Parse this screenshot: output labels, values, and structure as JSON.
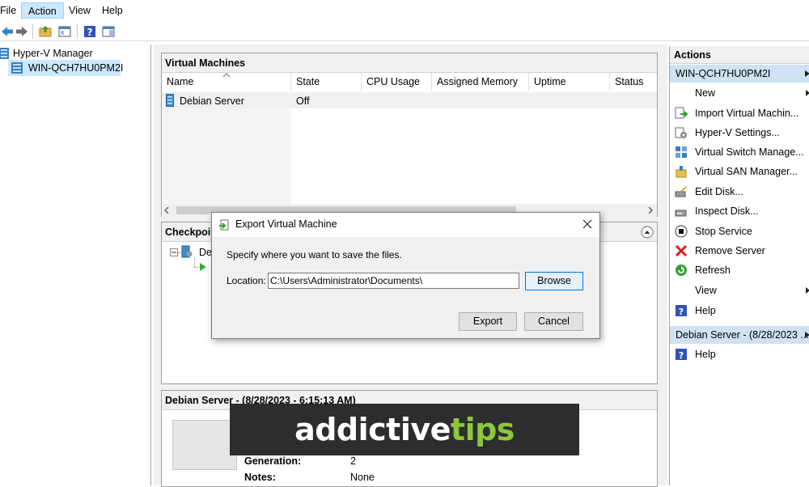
{
  "menu": {
    "file": "File",
    "action": "Action",
    "view": "View",
    "help": "Help"
  },
  "tree": {
    "root": "Hyper-V Manager",
    "server": "WIN-QCH7HU0PM2I"
  },
  "vm_panel": {
    "title": "Virtual Machines",
    "columns": [
      "Name",
      "State",
      "CPU Usage",
      "Assigned Memory",
      "Uptime",
      "Status"
    ],
    "rows": [
      {
        "name": "Debian Server",
        "state": "Off"
      }
    ]
  },
  "checkpoints_panel": {
    "title": "Checkpoi",
    "item": "Deb"
  },
  "details_panel": {
    "title": "Debian Server - (8/28/2023 - 6:15:13 AM)",
    "generation_label": "Generation:",
    "generation_value": "2",
    "notes_label": "Notes:",
    "notes_value": "None"
  },
  "actions": {
    "title": "Actions",
    "server_section": "WIN-QCH7HU0PM2I",
    "items": [
      "New",
      "Import Virtual Machin...",
      "Hyper-V Settings...",
      "Virtual Switch Manage...",
      "Virtual SAN Manager...",
      "Edit Disk...",
      "Inspect Disk...",
      "Stop Service",
      "Remove Server",
      "Refresh",
      "View",
      "Help"
    ],
    "vm_section": "Debian Server - (8/28/2023 ...",
    "vm_items": [
      "Help"
    ]
  },
  "dialog": {
    "title": "Export Virtual Machine",
    "instruction": "Specify where you want to save the files.",
    "location_label": "Location:",
    "location_value": "C:\\Users\\Administrator\\Documents\\",
    "browse": "Browse",
    "export": "Export",
    "cancel": "Cancel"
  },
  "watermark": {
    "part1": "addictive",
    "part2": "tips"
  },
  "colors": {
    "selection": "#cce8ff",
    "section_header": "#cfe2f3",
    "accent": "#0078d7",
    "watermark_green": "#8dc63f"
  }
}
